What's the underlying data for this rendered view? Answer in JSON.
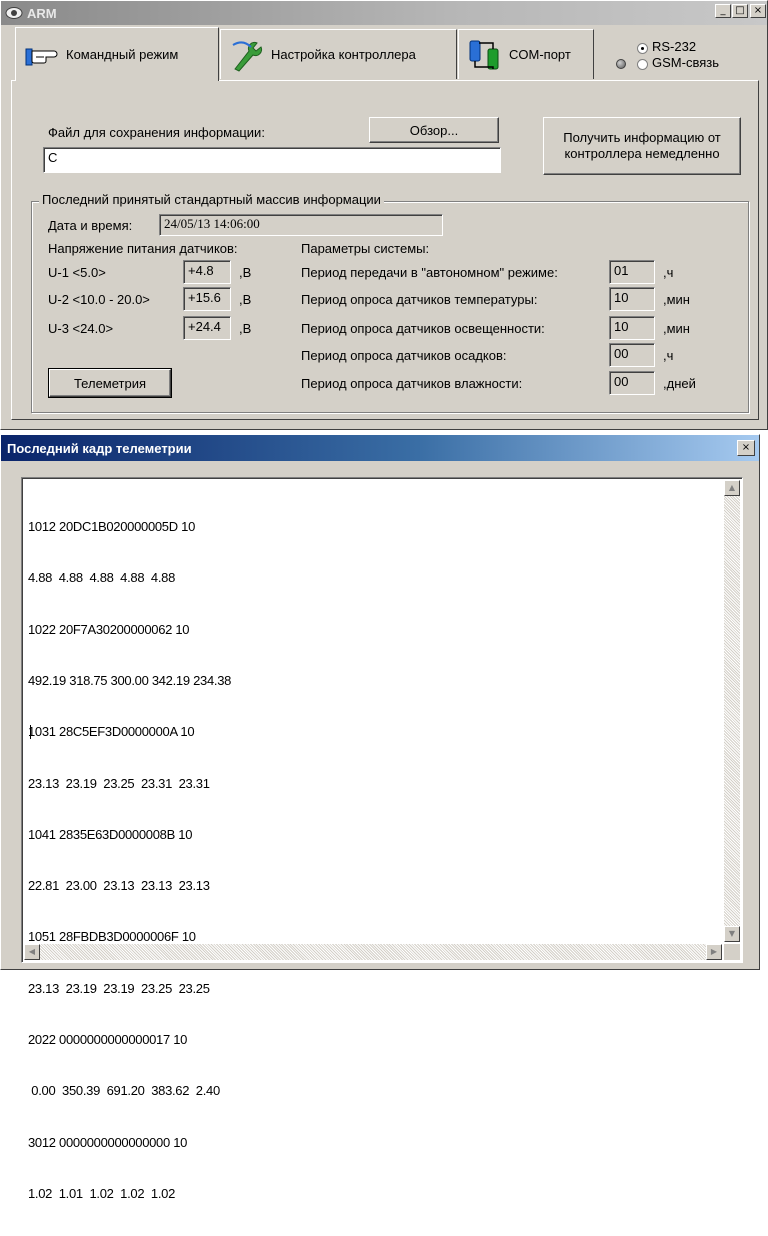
{
  "main_window": {
    "title": "ARM",
    "caption_buttons": {
      "minimize": "_",
      "maximize": "□",
      "close": "×"
    },
    "tabs": [
      {
        "label": "Командный режим",
        "icon": "pointing-hand-icon",
        "selected": true
      },
      {
        "label": "Настройка контроллера",
        "icon": "wrench-icon",
        "selected": false
      },
      {
        "label": "COM-порт",
        "icon": "com-port-icon",
        "selected": false
      }
    ],
    "connection": {
      "options": [
        {
          "label": "RS-232",
          "selected": true
        },
        {
          "label": "GSM-связь",
          "selected": false
        }
      ],
      "indicator": "status-led-icon"
    },
    "file": {
      "label": "Файл для сохранения информации:",
      "browse_label": "Обзор...",
      "path_value": "C"
    },
    "get_info_button": "Получить информацию от контроллера немедленно",
    "last_array": {
      "legend": "Последний принятый стандартный массив информации",
      "datetime_label": "Дата и время:",
      "datetime_value": "24/05/13 14:06:00",
      "sensor_voltage_label": "Напряжение питания датчиков:",
      "voltages": [
        {
          "name": "U-1 <5.0>",
          "value": "+4.8",
          "unit": ",В"
        },
        {
          "name": "U-2 <10.0 - 20.0>",
          "value": "+15.6",
          "unit": ",В"
        },
        {
          "name": "U-3 <24.0>",
          "value": "+24.4",
          "unit": ",В"
        }
      ],
      "system_params_label": "Параметры системы:",
      "params": [
        {
          "name": "Период передачи в \"автономном\" режиме:",
          "value": "01",
          "unit": ",ч"
        },
        {
          "name": "Период опроса датчиков температуры:",
          "value": "10",
          "unit": ",мин"
        },
        {
          "name": "Период опроса датчиков освещенности:",
          "value": "10",
          "unit": ",мин"
        },
        {
          "name": "Период опроса датчиков осадков:",
          "value": "00",
          "unit": ",ч"
        },
        {
          "name": "Период опроса датчиков влажности:",
          "value": "00",
          "unit": ",дней"
        }
      ],
      "telemetry_button": "Телеметрия"
    }
  },
  "telemetry_window": {
    "title": "Последний кадр телеметрии",
    "close": "×",
    "lines": [
      "1012 20DC1B020000005D 10",
      "4.88  4.88  4.88  4.88  4.88",
      "1022 20F7A30200000062 10",
      "492.19 318.75 300.00 342.19 234.38",
      "1031 28C5EF3D0000000A 10",
      "23.13  23.19  23.25  23.31  23.31",
      "1041 2835E63D0000008B 10",
      "22.81  23.00  23.13  23.13  23.13",
      "1051 28FBDB3D0000006F 10",
      "23.13  23.19  23.19  23.25  23.25",
      "2022 0000000000000017 10",
      " 0.00  350.39  691.20  383.62  2.40",
      "3012 0000000000000000 10",
      "1.02  1.01  1.02  1.02  1.02"
    ],
    "scroll": {
      "up": "▲",
      "down": "▼",
      "left": "◀",
      "right": "▶"
    }
  }
}
